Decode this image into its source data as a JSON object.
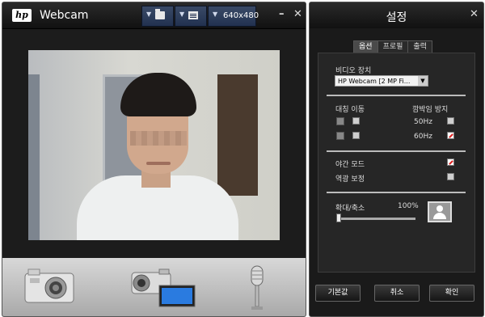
{
  "webcam_window": {
    "title": "Webcam",
    "logo_text": "hp",
    "resolution": "640x480",
    "minimize": "–",
    "close": "✕"
  },
  "settings_window": {
    "title": "설정",
    "close": "✕",
    "tabs": [
      "옵션",
      "프로필",
      "출력"
    ],
    "video_device_label": "비디오 장치",
    "video_device_value": "HP Webcam [2 MP Fi...",
    "mirror_label": "대칭 이동",
    "flicker_label": "깜박임 방지",
    "flicker_50": "50Hz",
    "flicker_60": "60Hz",
    "night_mode_label": "야간 모드",
    "backlight_label": "역광 보정",
    "zoom_label": "확대/축소",
    "zoom_value": "100%",
    "buttons": {
      "default": "기본값",
      "cancel": "취소",
      "ok": "확인"
    }
  },
  "state": {
    "flicker_50_checked": false,
    "flicker_60_checked": true,
    "night_mode_checked": true,
    "backlight_checked": false,
    "zoom_percent": 100
  },
  "icons": [
    "hp-logo",
    "folder-icon",
    "document-icon",
    "camera-icon",
    "camcorder-icon",
    "microphone-icon",
    "portrait-icon"
  ]
}
